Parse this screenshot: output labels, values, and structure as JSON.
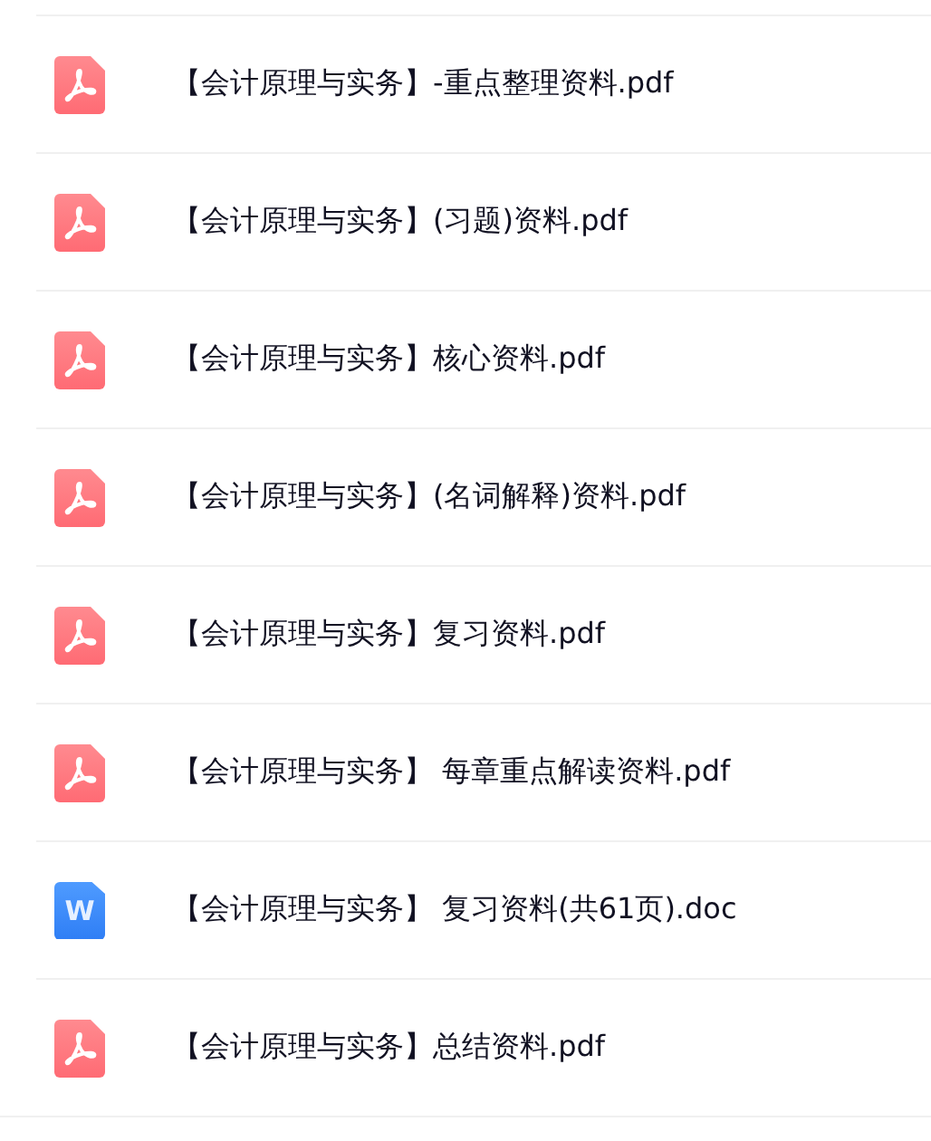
{
  "files": [
    {
      "kind": "pdf",
      "name": "【会计原理与实务】-重点整理资料.pdf"
    },
    {
      "kind": "pdf",
      "name": "【会计原理与实务】(习题)资料.pdf"
    },
    {
      "kind": "pdf",
      "name": "【会计原理与实务】核心资料.pdf"
    },
    {
      "kind": "pdf",
      "name": "【会计原理与实务】(名词解释)资料.pdf"
    },
    {
      "kind": "pdf",
      "name": "【会计原理与实务】复习资料.pdf"
    },
    {
      "kind": "pdf",
      "name": "【会计原理与实务】 每章重点解读资料.pdf"
    },
    {
      "kind": "doc",
      "name": "【会计原理与实务】 复习资料(共61页).doc",
      "icon_letter": "W"
    },
    {
      "kind": "pdf",
      "name": "【会计原理与实务】总结资料.pdf"
    }
  ]
}
